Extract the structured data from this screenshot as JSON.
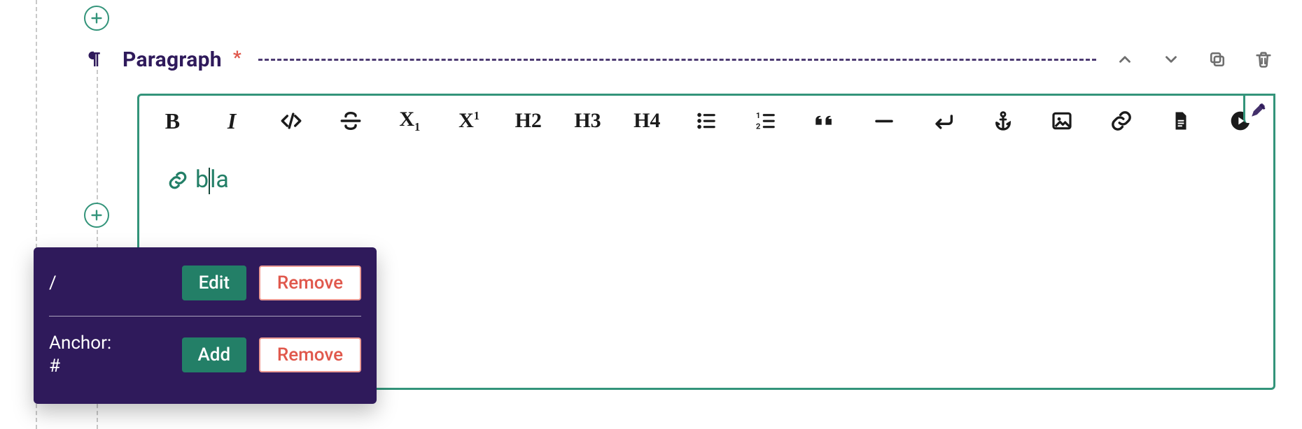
{
  "header": {
    "block_type_label": "Paragraph",
    "required_marker": "*"
  },
  "toolbar": {
    "bold": "B",
    "italic": "I",
    "h2": "H2",
    "h3": "H3",
    "h4": "H4"
  },
  "content": {
    "link_text_before_caret": "b",
    "link_text_after_caret": "la"
  },
  "popover": {
    "url_label": "/",
    "edit_label": "Edit",
    "remove_label": "Remove",
    "anchor_heading": "Anchor:",
    "anchor_value": "#",
    "add_label": "Add"
  }
}
